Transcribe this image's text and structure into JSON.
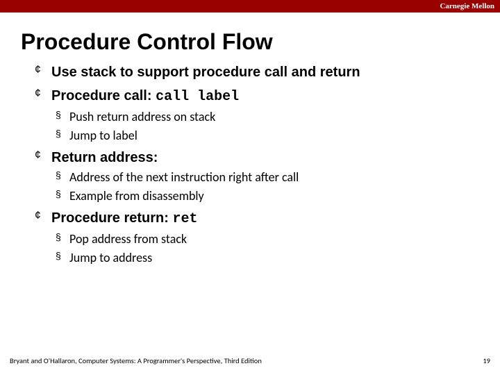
{
  "header": {
    "brand": "Carnegie Mellon"
  },
  "title": "Procedure Control Flow",
  "bullets": {
    "b0": "Use stack to support procedure call and return",
    "b1_pre": "Procedure call: ",
    "b1_code": "call label",
    "b1_s0_pre": "Push return address on stack",
    "b1_s1_pre": "Jump to ",
    "b1_s1_code": "label",
    "b2": "Return address:",
    "b2_s0": "Address of the next instruction right after call",
    "b2_s1": "Example from disassembly",
    "b3_pre": "Procedure return: ",
    "b3_code": "ret",
    "b3_s0": "Pop address from stack",
    "b3_s1": "Jump to address"
  },
  "footer": {
    "credit": "Bryant and O'Hallaron, Computer Systems: A Programmer's Perspective, Third Edition",
    "page": "19"
  }
}
